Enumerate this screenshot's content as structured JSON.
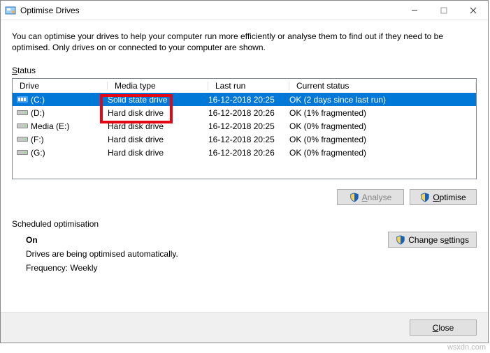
{
  "window": {
    "title": "Optimise Drives"
  },
  "description": "You can optimise your drives to help your computer run more efficiently or analyse them to find out if they need to be optimised. Only drives on or connected to your computer are shown.",
  "status_label": "Status",
  "columns": {
    "drive": "Drive",
    "media": "Media type",
    "last": "Last run",
    "status": "Current status"
  },
  "rows": [
    {
      "icon": "ssd",
      "name": "(C:)",
      "media": "Solid state drive",
      "last": "16-12-2018 20:25",
      "status": "OK (2 days since last run)",
      "selected": true
    },
    {
      "icon": "hdd",
      "name": "(D:)",
      "media": "Hard disk drive",
      "last": "16-12-2018 20:26",
      "status": "OK (1% fragmented)",
      "selected": false
    },
    {
      "icon": "hdd",
      "name": "Media (E:)",
      "media": "Hard disk drive",
      "last": "16-12-2018 20:25",
      "status": "OK (0% fragmented)",
      "selected": false
    },
    {
      "icon": "hdd",
      "name": "(F:)",
      "media": "Hard disk drive",
      "last": "16-12-2018 20:25",
      "status": "OK (0% fragmented)",
      "selected": false
    },
    {
      "icon": "hdd",
      "name": "(G:)",
      "media": "Hard disk drive",
      "last": "16-12-2018 20:26",
      "status": "OK (0% fragmented)",
      "selected": false
    }
  ],
  "buttons": {
    "analyse": "Analyse",
    "optimise": "Optimise",
    "change_settings": "Change settings",
    "close": "Close"
  },
  "scheduled": {
    "label": "Scheduled optimisation",
    "status": "On",
    "line1": "Drives are being optimised automatically.",
    "line2": "Frequency: Weekly"
  },
  "watermark": "wsxdn.com"
}
